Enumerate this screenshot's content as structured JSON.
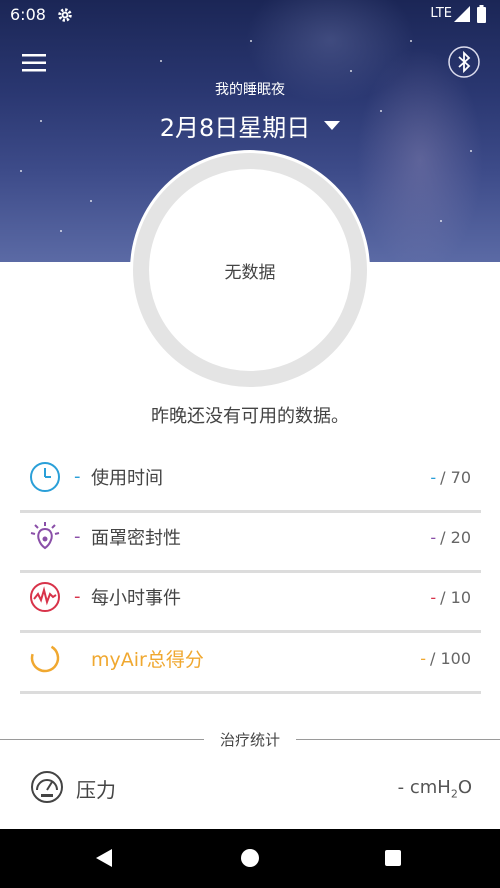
{
  "status_bar": {
    "time": "6:08",
    "network": "LTE"
  },
  "header": {
    "subtitle": "我的睡眠夜",
    "date": "2月8日星期日"
  },
  "ring": {
    "center_text": "无数据"
  },
  "message": "昨晚还没有可用的数据。",
  "metrics": [
    {
      "label": "使用时间",
      "dash": "-",
      "value_dash": "-",
      "max": "/ 70",
      "icon": "clock-icon",
      "color": "#2a9fd8"
    },
    {
      "label": "面罩密封性",
      "dash": "-",
      "value_dash": "-",
      "max": "/ 20",
      "icon": "mask-seal-icon",
      "color": "#8a4fa8"
    },
    {
      "label": "每小时事件",
      "dash": "-",
      "value_dash": "-",
      "max": "/ 10",
      "icon": "events-wave-icon",
      "color": "#d8334a"
    },
    {
      "label": "myAir总得分",
      "dash": "",
      "value_dash": "-",
      "max": "/ 100",
      "icon": "score-ring-icon",
      "color": "#f0a830"
    }
  ],
  "section": {
    "title": "治疗统计"
  },
  "pressure": {
    "label": "压力",
    "value": "- cmH",
    "subscript": "2",
    "suffix": "O",
    "icon": "gauge-icon"
  },
  "colors": {
    "hero_top": "#1b2656",
    "ring": "#e4e4e4",
    "divider": "#dcdcdc"
  }
}
